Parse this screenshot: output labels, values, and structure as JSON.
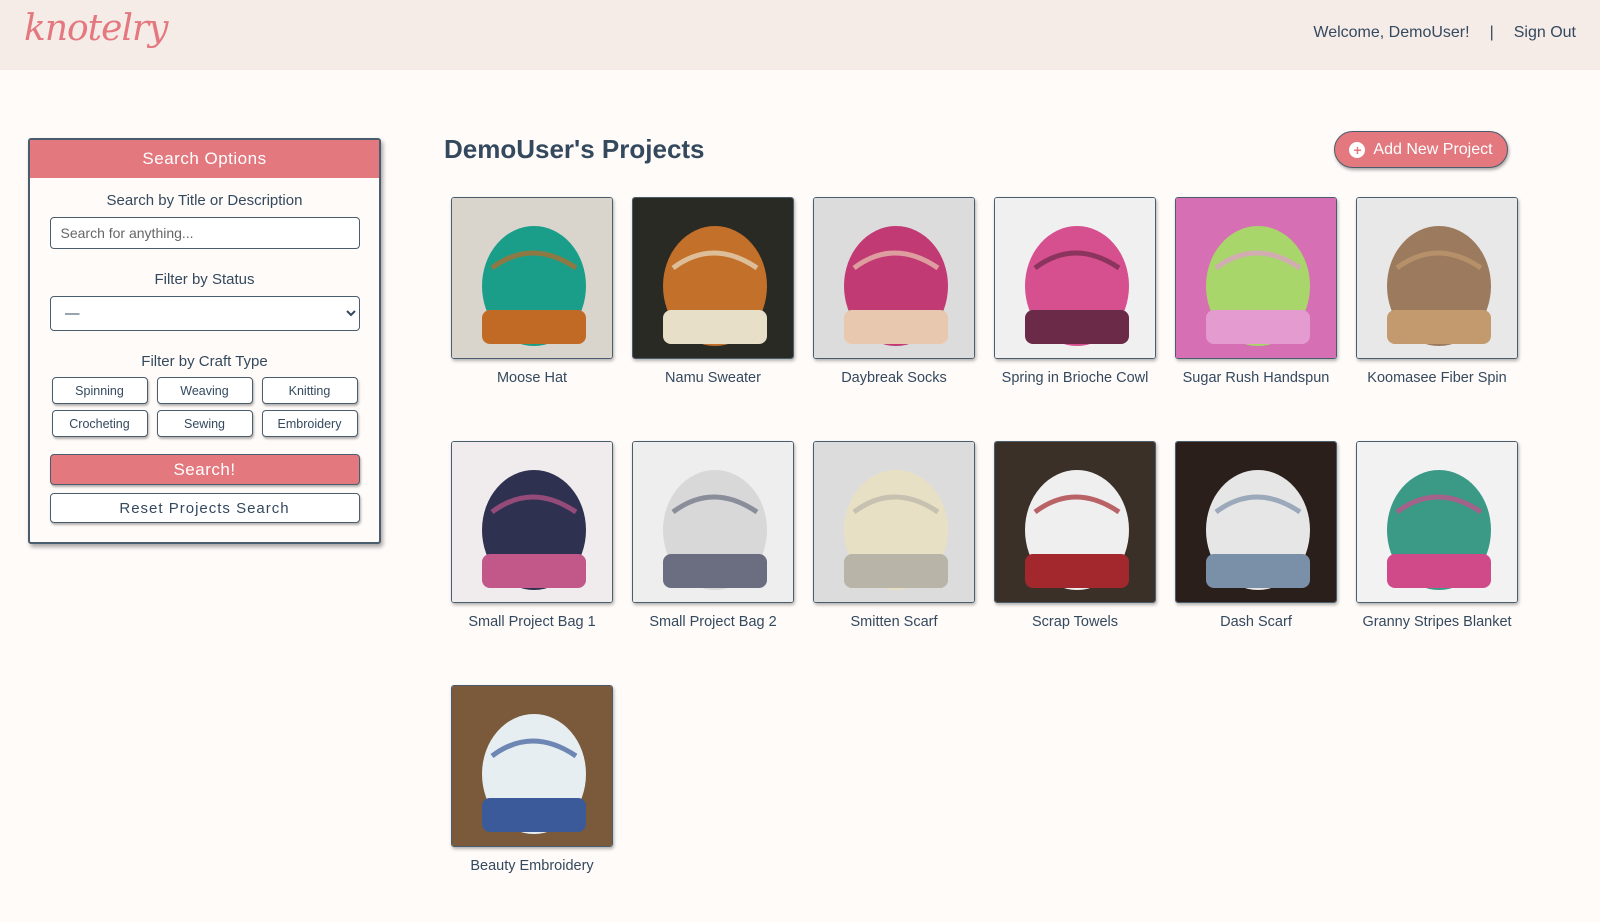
{
  "header": {
    "logo": "knotelry",
    "welcome": "Welcome, DemoUser!",
    "separator": "|",
    "sign_out": "Sign Out"
  },
  "sidebar": {
    "title": "Search Options",
    "search_label": "Search by Title or Description",
    "search_placeholder": "Search for anything...",
    "search_value": "",
    "status_label": "Filter by Status",
    "status_selected": "—",
    "craft_label": "Filter by Craft Type",
    "craft_types": [
      "Spinning",
      "Weaving",
      "Knitting",
      "Crocheting",
      "Sewing",
      "Embroidery"
    ],
    "search_button": "Search!",
    "reset_button": "Reset Projects Search"
  },
  "main": {
    "title": "DemoUser's Projects",
    "add_button": "Add New Project",
    "projects": [
      {
        "title": "Moose Hat",
        "colors": [
          "#d9d4cc",
          "#1a9e8a",
          "#c16a26"
        ]
      },
      {
        "title": "Namu Sweater",
        "colors": [
          "#2a2a24",
          "#c2702a",
          "#e8dfc8"
        ]
      },
      {
        "title": "Daybreak Socks",
        "colors": [
          "#dcdcdc",
          "#c23a73",
          "#e9c8b0"
        ]
      },
      {
        "title": "Spring in Brioche Cowl",
        "colors": [
          "#f0f0f0",
          "#d64f8e",
          "#6b2a48"
        ]
      },
      {
        "title": "Sugar Rush Handspun",
        "colors": [
          "#d66fb4",
          "#a8d66a",
          "#e39bd0"
        ]
      },
      {
        "title": "Koomasee Fiber Spin",
        "colors": [
          "#e8e8e8",
          "#9b7a5e",
          "#c29a6e"
        ]
      },
      {
        "title": "Small Project Bag 1",
        "colors": [
          "#f0ecee",
          "#2e3150",
          "#c2578a"
        ]
      },
      {
        "title": "Small Project Bag 2",
        "colors": [
          "#eeeeee",
          "#d8d8d8",
          "#6a6e80"
        ]
      },
      {
        "title": "Smitten Scarf",
        "colors": [
          "#dcdcdc",
          "#e8e0c4",
          "#b8b4a8"
        ]
      },
      {
        "title": "Scrap Towels",
        "colors": [
          "#3a3028",
          "#efefef",
          "#a3282e"
        ]
      },
      {
        "title": "Dash Scarf",
        "colors": [
          "#2a1f1a",
          "#e6e6e6",
          "#7a8fa8"
        ]
      },
      {
        "title": "Granny Stripes Blanket",
        "colors": [
          "#f2f2f2",
          "#3a9a86",
          "#d04a8a"
        ]
      },
      {
        "title": "Beauty Embroidery",
        "colors": [
          "#7a5a3a",
          "#e6eef2",
          "#3a5a9a"
        ]
      }
    ]
  }
}
